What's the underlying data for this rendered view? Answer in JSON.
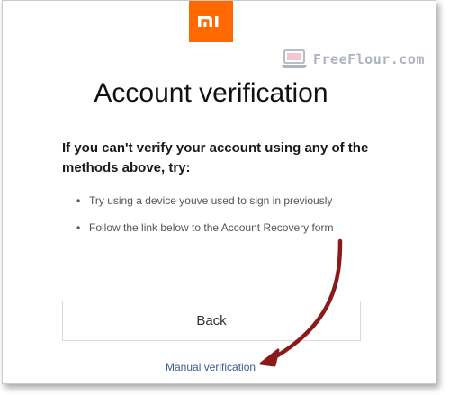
{
  "brand": {
    "logo_icon": "mi-logo-icon",
    "logo_text": "mi",
    "color": "#ff6900"
  },
  "watermark": {
    "icon": "laptop-icon",
    "text": "FreeFlour.com"
  },
  "page": {
    "title": "Account verification",
    "intro": "If you can't verify your account using any of the methods above, try:",
    "bullets": [
      "Try using a device youve used to sign in previously",
      "Follow the link below to the Account Recovery form"
    ]
  },
  "actions": {
    "back_label": "Back",
    "manual_link": "Manual verification"
  },
  "annotation": {
    "arrow_color": "#8b1a1a"
  }
}
